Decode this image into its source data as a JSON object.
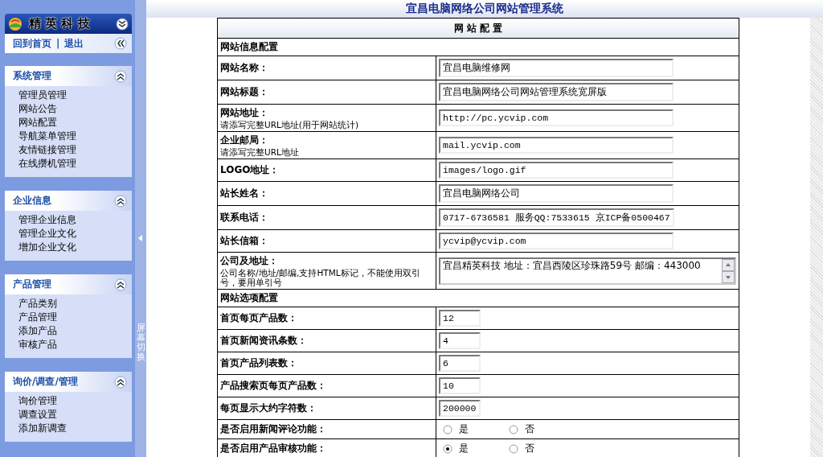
{
  "sidebar": {
    "logo": "精 英 科 技",
    "links": [
      "回到首页",
      "|",
      "退出"
    ],
    "groups": [
      {
        "title": "系统管理",
        "expanded": true,
        "items": [
          "管理员管理",
          "网站公告",
          "网站配置",
          "导航菜单管理",
          "友情链接管理",
          "在线攒机管理"
        ]
      },
      {
        "title": "企业信息",
        "expanded": true,
        "items": [
          "管理企业信息",
          "管理企业文化",
          "增加企业文化"
        ]
      },
      {
        "title": "产品管理",
        "expanded": true,
        "items": [
          "产品类别",
          "产品管理",
          "添加产品",
          "审核产品"
        ]
      },
      {
        "title": "询价/调查/管理",
        "expanded": true,
        "items": [
          "询价管理",
          "调查设置",
          "添加新调查"
        ]
      }
    ]
  },
  "splitter": {
    "label": "屏幕切换"
  },
  "page_title": "宜昌电脑网络公司网站管理系统",
  "table": {
    "title": "网 站 配 置",
    "rows": [
      {
        "kind": "section",
        "label": "网站信息配置"
      },
      {
        "kind": "text",
        "label": "网站名称：",
        "value": "宜昌电脑维修网"
      },
      {
        "kind": "text",
        "label": "网站标题：",
        "value": "宜昌电脑网络公司网站管理系统宽屏版"
      },
      {
        "kind": "text",
        "label": "网站地址：",
        "hint": "请添写完整URL地址(用于网站统计)",
        "value": "http://pc.ycvip.com"
      },
      {
        "kind": "text",
        "label": "企业邮局：",
        "hint": "请添写完整URL地址",
        "value": "mail.ycvip.com"
      },
      {
        "kind": "text",
        "label": "LOGO地址：",
        "value": "images/logo.gif"
      },
      {
        "kind": "text",
        "label": "站长姓名：",
        "value": "宜昌电脑网络公司"
      },
      {
        "kind": "text",
        "label": "联系电话：",
        "value": "0717-6736581 服务QQ:7533615 京ICP备0500467"
      },
      {
        "kind": "text",
        "label": "站长信箱：",
        "value": "ycvip@ycvip.com"
      },
      {
        "kind": "textarea",
        "label": "公司及地址：",
        "hint": "公司名称/地址/邮编,支持HTML标记，不能使用双引号，要用单引号",
        "value": "宜昌精英科技  地址：宜昌西陵区珍珠路59号 邮编：443000"
      },
      {
        "kind": "section",
        "label": "网站选项配置"
      },
      {
        "kind": "number",
        "label": "首页每页产品数：",
        "value": "12"
      },
      {
        "kind": "number",
        "label": "首页新闻资讯条数：",
        "value": "4"
      },
      {
        "kind": "number",
        "label": "首页产品列表数：",
        "value": "6"
      },
      {
        "kind": "number",
        "label": "产品搜索页每页产品数：",
        "value": "10"
      },
      {
        "kind": "number",
        "label": "每页显示大约字符数：",
        "value": "200000"
      },
      {
        "kind": "radio",
        "label": "是否启用新闻评论功能：",
        "options": [
          {
            "label": "是",
            "selected": false
          },
          {
            "label": "否",
            "selected": false
          }
        ]
      },
      {
        "kind": "radio",
        "label": "是否启用产品审核功能：",
        "options": [
          {
            "label": "是",
            "selected": true
          },
          {
            "label": "否",
            "selected": false
          }
        ]
      }
    ]
  }
}
